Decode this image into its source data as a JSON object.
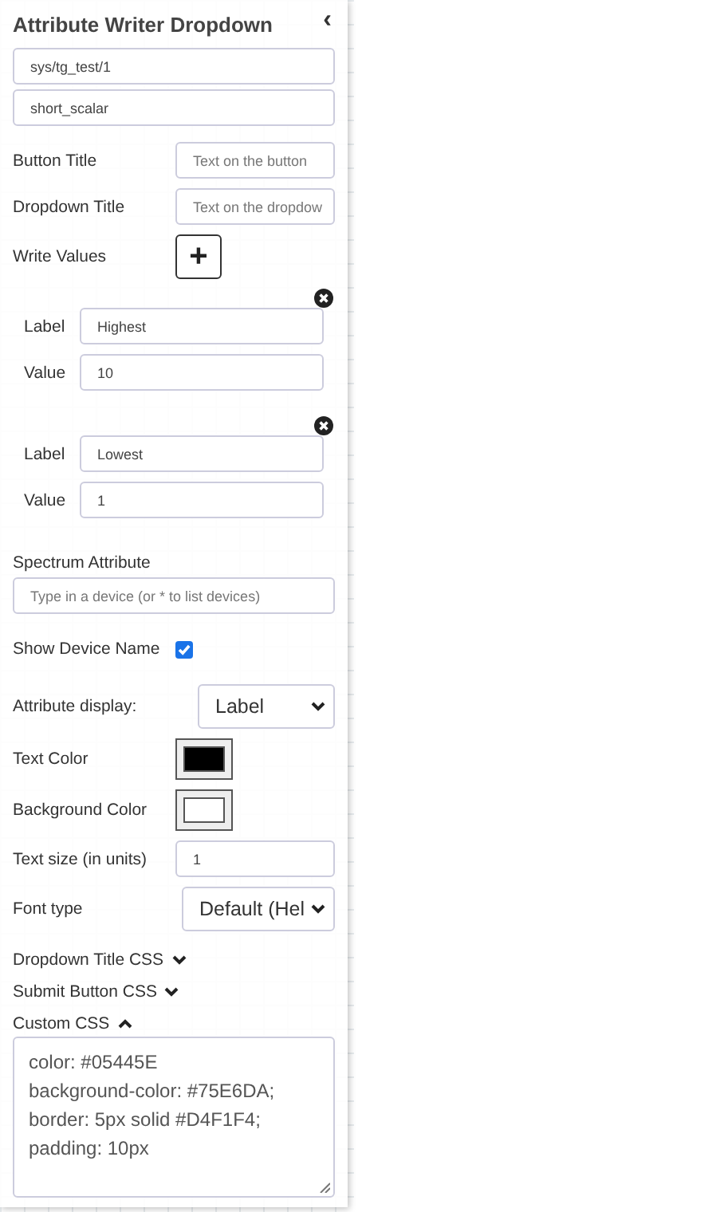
{
  "panel": {
    "title": "Attribute Writer Dropdown",
    "collapse_icon": "‹"
  },
  "device_field": {
    "value": "sys/tg_test/1"
  },
  "attribute_field": {
    "value": "short_scalar"
  },
  "button_title": {
    "label": "Button Title",
    "placeholder": "Text on the button"
  },
  "dropdown_title": {
    "label": "Dropdown Title",
    "placeholder": "Text on the dropdow"
  },
  "write_values": {
    "label": "Write Values",
    "add_icon": "+",
    "entries": [
      {
        "label_caption": "Label",
        "label_value": "Highest",
        "value_caption": "Value",
        "value": "10"
      },
      {
        "label_caption": "Label",
        "label_value": "Lowest",
        "value_caption": "Value",
        "value": "1"
      }
    ]
  },
  "spectrum_attribute": {
    "label": "Spectrum Attribute",
    "placeholder": "Type in a device (or * to list devices)"
  },
  "show_device_name": {
    "label": "Show Device Name",
    "checked": true
  },
  "attribute_display": {
    "label": "Attribute display:",
    "value": "Label"
  },
  "text_color": {
    "label": "Text Color",
    "color": "#000000"
  },
  "background_color": {
    "label": "Background Color",
    "color": "#ffffff"
  },
  "text_size": {
    "label": "Text size (in units)",
    "value": "1"
  },
  "font_type": {
    "label": "Font type",
    "value": "Default (Hel"
  },
  "sections": [
    {
      "label": "Dropdown Title CSS",
      "expanded": false
    },
    {
      "label": "Submit Button CSS",
      "expanded": false
    },
    {
      "label": "Custom CSS",
      "expanded": true
    }
  ],
  "custom_css": {
    "value": "color: #05445E\nbackground-color: #75E6DA;\nborder: 5px solid #D4F1F4;\npadding: 10px"
  }
}
